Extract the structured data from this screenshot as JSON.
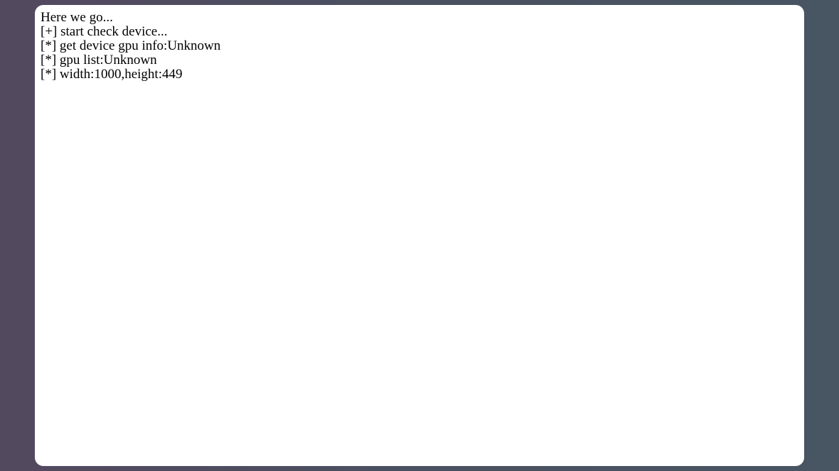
{
  "console": {
    "lines": [
      "Here we go...",
      "[+] start check device...",
      "[*] get device gpu info:Unknown",
      "[*] gpu list:Unknown",
      "[*] width:1000,height:449"
    ]
  }
}
